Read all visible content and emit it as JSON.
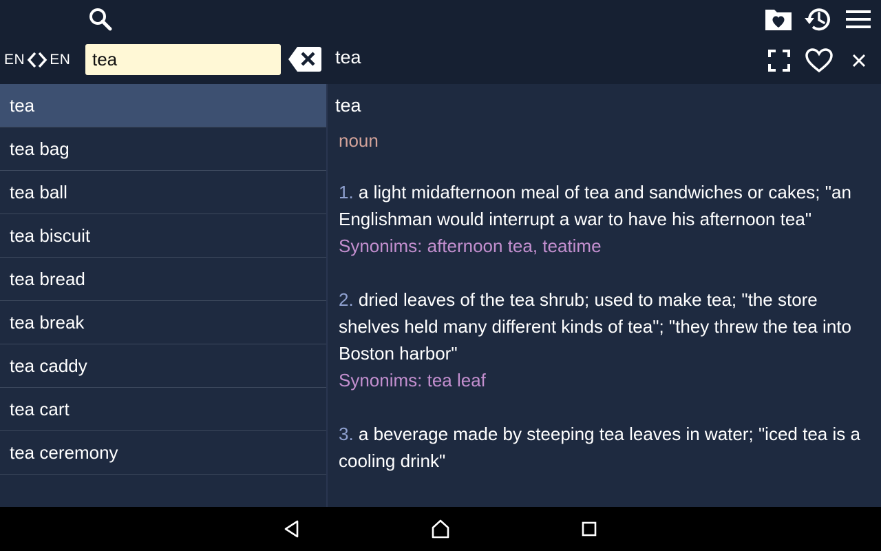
{
  "header": {
    "source_lang": "EN",
    "target_lang": "EN",
    "search_value": "tea",
    "search_placeholder": "",
    "entry_title": "tea"
  },
  "icons": {
    "search": "search-icon",
    "favorites_folder": "favorites-folder-icon",
    "history": "history-icon",
    "menu": "menu-icon",
    "clear": "clear-input-icon",
    "fullscreen": "fullscreen-icon",
    "favorite": "heart-icon",
    "close": "close-icon"
  },
  "word_list": [
    "tea",
    "tea bag",
    "tea ball",
    "tea biscuit",
    "tea bread",
    "tea break",
    "tea caddy",
    "tea cart",
    "tea ceremony"
  ],
  "selected_index": 0,
  "definition": {
    "word": "tea",
    "part_of_speech": "noun",
    "senses": [
      {
        "num": "1.",
        "text": "a light midafternoon meal of tea and sandwiches or cakes; \"an Englishman would interrupt a war to have his afternoon tea\"",
        "synonyms": "Synonims: afternoon tea, teatime"
      },
      {
        "num": "2.",
        "text": "dried leaves of the tea shrub; used to make tea; \"the store shelves held many different kinds of tea\"; \"they threw the tea into Boston harbor\"",
        "synonyms": "Synonims: tea leaf"
      },
      {
        "num": "3.",
        "text": "a beverage made by steeping tea leaves in water; \"iced tea is a cooling drink\"",
        "synonyms": ""
      }
    ]
  },
  "colors": {
    "background": "#1e2a40",
    "topbar": "#162032",
    "selected_row": "#3d5071",
    "search_field": "#fff8d6",
    "part_of_speech": "#d4a39a",
    "sense_number": "#8fa1d0",
    "synonyms": "#c38fcf"
  },
  "navbar": {
    "back": "back-icon",
    "home": "home-icon",
    "recents": "recents-icon"
  }
}
